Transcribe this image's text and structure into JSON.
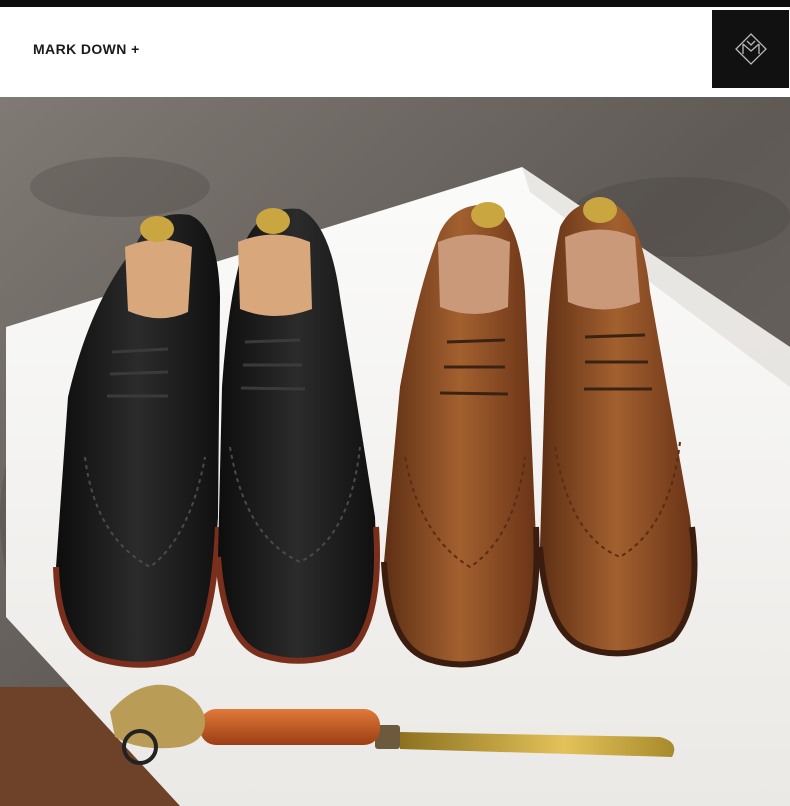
{
  "header": {
    "title": "MARK DOWN +",
    "logo_icon": "brand-monogram-logo"
  },
  "photo": {
    "subject": "product-photo",
    "colors": {
      "wall": "#6f6a66",
      "pedestal": "#f3f2f0",
      "floor": "#7a4a2e",
      "black_shoe": "#1b1b1b",
      "brown_shoe": "#8a4a24",
      "shoe_tree_wood": "#d9a77c",
      "brass": "#c9a640",
      "shoehorn_handle": "#c0561f"
    }
  }
}
